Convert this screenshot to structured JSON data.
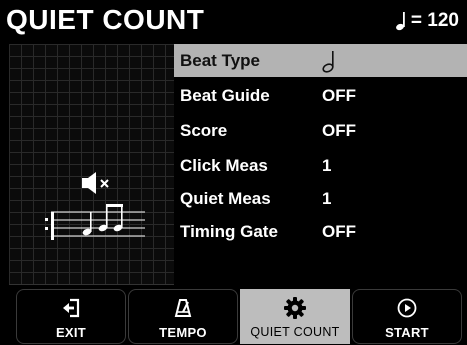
{
  "header": {
    "title": "QUIET COUNT",
    "tempo_value": "= 120",
    "tempo_icon": "quarter-note-icon"
  },
  "left_panel": {
    "speaker_icon": "speaker-muted-icon",
    "staff_icon": "staff-notes-icon"
  },
  "menu": {
    "items": [
      {
        "label": "Beat Type",
        "value": "",
        "value_icon": "half-note-icon",
        "selected": true
      },
      {
        "label": "Beat Guide",
        "value": "OFF"
      },
      {
        "label": "Score",
        "value": "OFF"
      },
      {
        "label": "Click Meas",
        "value": "1"
      },
      {
        "label": "Quiet Meas",
        "value": "1"
      },
      {
        "label": "Timing Gate",
        "value": "OFF"
      }
    ]
  },
  "toolbar": {
    "buttons": [
      {
        "label": "EXIT",
        "icon": "exit-icon"
      },
      {
        "label": "TEMPO",
        "icon": "metronome-icon"
      },
      {
        "label": "QUIET COUNT",
        "icon": "gear-icon",
        "active": true
      },
      {
        "label": "START",
        "icon": "play-icon"
      }
    ]
  },
  "colors": {
    "background": "#000000",
    "selected_row": "#b3b3b3",
    "active_button": "#bdbdbd",
    "text": "#ffffff"
  }
}
